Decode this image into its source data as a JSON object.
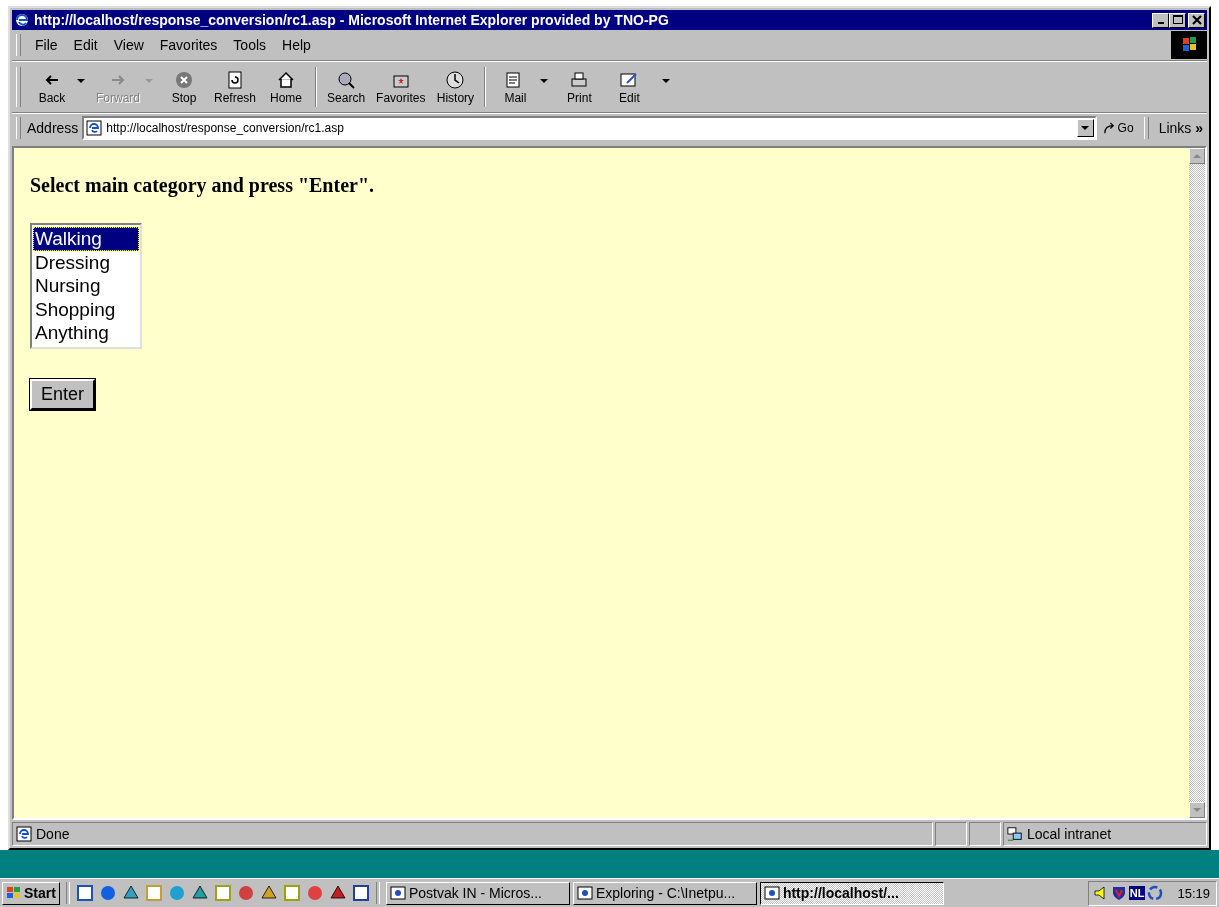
{
  "window": {
    "title": "http://localhost/response_conversion/rc1.asp - Microsoft Internet Explorer provided by TNO-PG"
  },
  "menu": [
    "File",
    "Edit",
    "View",
    "Favorites",
    "Tools",
    "Help"
  ],
  "toolbar": {
    "groups": [
      [
        {
          "label": "Back",
          "disabled": false,
          "dropdown": true
        },
        {
          "label": "Forward",
          "disabled": true,
          "dropdown": true
        },
        {
          "label": "Stop",
          "disabled": false,
          "dropdown": false
        },
        {
          "label": "Refresh",
          "disabled": false,
          "dropdown": false
        },
        {
          "label": "Home",
          "disabled": false,
          "dropdown": false
        }
      ],
      [
        {
          "label": "Search",
          "disabled": false,
          "dropdown": false
        },
        {
          "label": "Favorites",
          "disabled": false,
          "dropdown": false
        },
        {
          "label": "History",
          "disabled": false,
          "dropdown": false
        }
      ],
      [
        {
          "label": "Mail",
          "disabled": false,
          "dropdown": true
        },
        {
          "label": "Print",
          "disabled": false,
          "dropdown": false
        },
        {
          "label": "Edit",
          "disabled": false,
          "dropdown": false
        }
      ]
    ],
    "more": true
  },
  "address": {
    "label": "Address",
    "value": "http://localhost/response_conversion/rc1.asp",
    "go": "Go",
    "links": "Links",
    "links_more": "»"
  },
  "page": {
    "heading": "Select main category and press \"Enter\".",
    "listbox": [
      {
        "label": "Walking",
        "selected": true
      },
      {
        "label": "Dressing",
        "selected": false
      },
      {
        "label": "Nursing",
        "selected": false
      },
      {
        "label": "Shopping",
        "selected": false
      },
      {
        "label": "Anything",
        "selected": false
      }
    ],
    "button": "Enter"
  },
  "status": {
    "text": "Done",
    "zone": "Local intranet"
  },
  "taskbar": {
    "start": "Start",
    "tasks": [
      {
        "label": "Postvak IN - Micros...",
        "selected": false
      },
      {
        "label": "Exploring - C:\\Inetpu...",
        "selected": false
      },
      {
        "label": "http://localhost/...",
        "selected": true
      }
    ],
    "tray": {
      "language": "NL",
      "clock": "15:19"
    }
  }
}
